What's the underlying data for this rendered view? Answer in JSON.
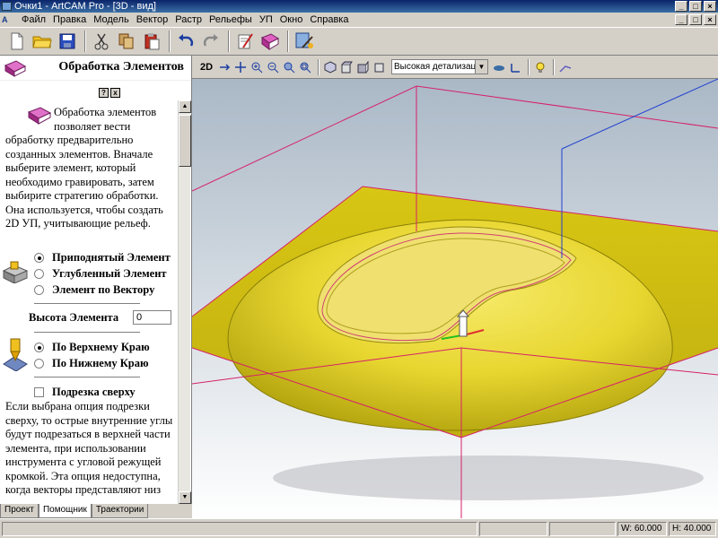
{
  "window": {
    "title": "Очки1 - ArtCAM Pro - [3D - вид]"
  },
  "menu": [
    "Файл",
    "Правка",
    "Модель",
    "Вектор",
    "Растр",
    "Рельефы",
    "УП",
    "Окно",
    "Справка"
  ],
  "toolbar_icons": [
    "new-file-icon",
    "open-folder-icon",
    "save-icon",
    "cut-icon",
    "copy-icon",
    "paste-icon",
    "undo-icon",
    "redo-icon",
    "edit-notes-icon",
    "book-icon",
    "wizard-icon"
  ],
  "panel": {
    "title": "Обработка Элементов",
    "help_btn": "?",
    "close_btn": "x",
    "description": "Обработка элементов позволяет вести обработку предварительно созданных элементов. Вначале выберите элемент, который необходимо гравировать, затем выбирите стратегию обработки. Она используется, чтобы создать 2D УП, учитывающие рельеф.",
    "options": {
      "raised": "Приподнятый Элемент",
      "recessed": "Углубленный Элемент",
      "vector": "Элемент по Вектору"
    },
    "height_label": "Высота Элемента",
    "height_value": "0",
    "edge": {
      "top": "По Верхнему Краю",
      "bottom": "По Нижнему Краю"
    },
    "undercut_label": "Подрезка сверху",
    "undercut_desc": "Если выбрана опция подрезки сверху, то острые внутренние углы будут подрезаться в верхней части элемента, при использовании инструмента с угловой режущей кромкой. Эта опция недоступна, когда векторы представляют низ"
  },
  "tabs": [
    "Проект",
    "Помощник",
    "Траектории"
  ],
  "view_toolbar": {
    "mode_2d": "2D",
    "detail_level": "Высокая детализация"
  },
  "status": {
    "width": "W: 60.000",
    "height": "H: 40.000"
  },
  "colors": {
    "background": "#d4d0c8",
    "viewport_top": "#aebbc8",
    "relief": "#e3d21c",
    "bounding_box": "#d6206a"
  }
}
